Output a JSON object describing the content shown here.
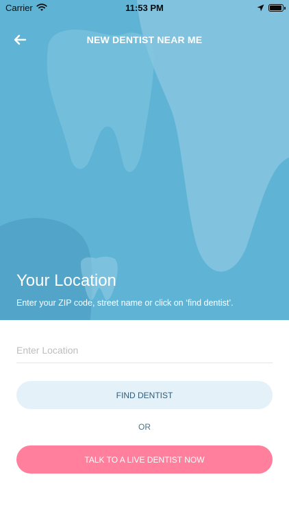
{
  "status_bar": {
    "carrier": "Carrier",
    "time": "11:53 PM",
    "battery_level": 0.95,
    "icons": [
      "wifi-icon",
      "location-arrow-icon",
      "battery-icon"
    ]
  },
  "nav": {
    "title": "NEW DENTIST NEAR ME",
    "back_icon": "arrow-left-icon"
  },
  "hero": {
    "title": "Your Location",
    "subtitle": "Enter your ZIP code, street name or click on ‘find dentist’.",
    "decorations": [
      "tooth-illustration",
      "small-tooth-illustration"
    ]
  },
  "form": {
    "location_placeholder": "Enter Location",
    "location_value": ""
  },
  "actions": {
    "find_label": "FIND DENTIST",
    "or_label": "OR",
    "live_label": "TALK TO A LIVE DENTIST NOW"
  },
  "colors": {
    "hero_bg": "#5fb4d6",
    "find_button_bg": "#e5f1f8",
    "find_button_text": "#2f5c78",
    "live_button_bg": "#ff7f9d"
  }
}
